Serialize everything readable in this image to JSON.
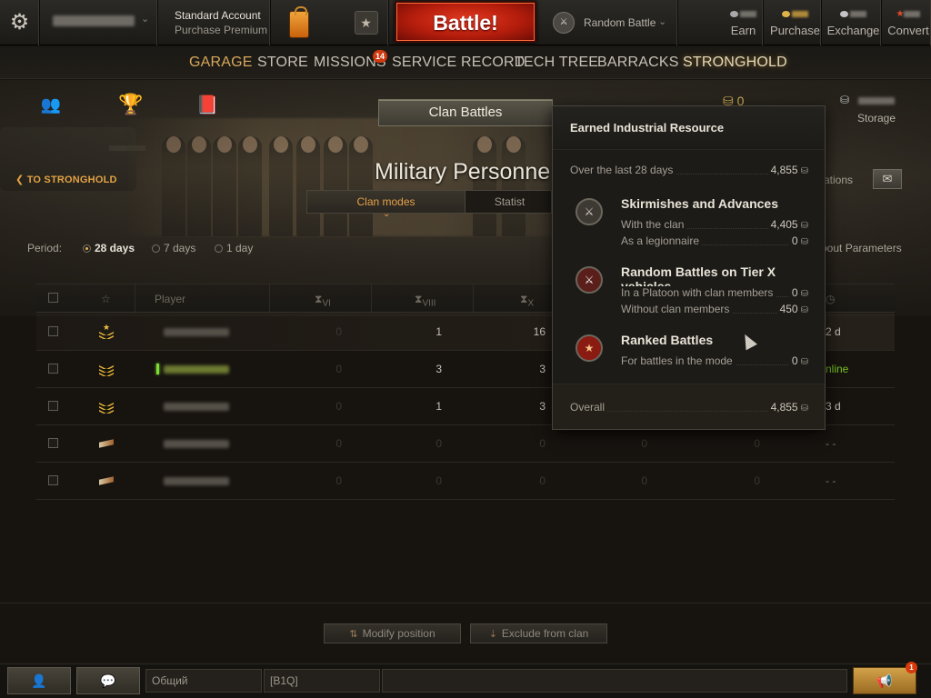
{
  "top_bar": {
    "account_title": "Standard Account",
    "account_sub": "Purchase Premium",
    "battle_label": "Battle!",
    "battle_mode": "Random Battle",
    "earn_label": "Earn",
    "purchase_label": "Purchase",
    "exchange_label": "Exchange",
    "convert_label": "Convert"
  },
  "nav": {
    "items": [
      "GARAGE",
      "STORE",
      "MISSIONS",
      "SERVICE RECORD",
      "TECH TREE",
      "BARRACKS",
      "STRONGHOLD"
    ],
    "missions_badge": "14",
    "active": "STRONGHOLD"
  },
  "stronghold": {
    "clan_battles_label": "Clan Battles",
    "gold_value": "0",
    "storage_label": "Storage",
    "back_link": "TO STRONGHOLD",
    "page_title": "Military Personne",
    "invitations_label": "itations",
    "tabs": [
      "Clan modes",
      "Statist"
    ],
    "about_label": "bout Parameters"
  },
  "filters": {
    "period_label": "Period:",
    "options": [
      "28 days",
      "7 days",
      "1 day"
    ],
    "selected": "28 days"
  },
  "table": {
    "player_header": "Player",
    "col_headers": [
      "VI",
      "VIII",
      "X"
    ],
    "rows": [
      {
        "vi": "0",
        "viii": "1",
        "x": "16",
        "c4": "",
        "c5": "",
        "last": "2 d",
        "online": false
      },
      {
        "vi": "0",
        "viii": "3",
        "x": "3",
        "c4": "",
        "c5": "",
        "last": "nline",
        "online": true
      },
      {
        "vi": "0",
        "viii": "1",
        "x": "3",
        "c4": "",
        "c5": "",
        "last": "3 d",
        "online": false
      },
      {
        "vi": "0",
        "viii": "0",
        "x": "0",
        "c4": "0",
        "c5": "0",
        "last": "- -",
        "online": false
      },
      {
        "vi": "0",
        "viii": "0",
        "x": "0",
        "c4": "0",
        "c5": "0",
        "last": "- -",
        "online": false
      }
    ]
  },
  "actions": {
    "modify_position": "Modify position",
    "exclude_from_clan": "Exclude from clan"
  },
  "footer": {
    "channel_general": "Общий",
    "channel_clan": "[B1Q]",
    "notifications_count": "1"
  },
  "tooltip": {
    "title": "Earned Industrial Resource",
    "last_28_label": "Over the last 28 days",
    "last_28_value": "4,855",
    "sections": [
      {
        "title": "Skirmishes and Advances",
        "rows": [
          {
            "label": "With the clan",
            "value": "4,405"
          },
          {
            "label": "As a legionnaire",
            "value": "0"
          }
        ]
      },
      {
        "title": "Random Battles on Tier X vehicles",
        "rows": [
          {
            "label": "In a Platoon with clan members",
            "value": "0"
          },
          {
            "label": "Without clan members",
            "value": "450"
          }
        ]
      },
      {
        "title": "Ranked Battles",
        "rows": [
          {
            "label": "For battles in the mode",
            "value": "0"
          }
        ]
      }
    ],
    "overall_label": "Overall",
    "overall_value": "4,855"
  }
}
